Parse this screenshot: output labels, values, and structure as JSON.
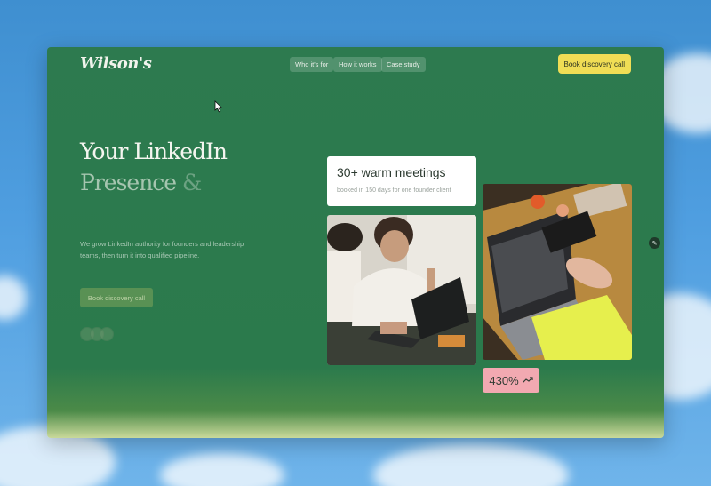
{
  "brand": {
    "logo_text": "Wilson's"
  },
  "nav": {
    "links": [
      {
        "label": "Who it's for"
      },
      {
        "label": "How it works"
      },
      {
        "label": "Case study"
      }
    ],
    "cta_label": "Book discovery call"
  },
  "hero": {
    "headline_line1": "Your LinkedIn",
    "headline_line2": "Presence",
    "headline_amp": "&",
    "subtext": "We grow LinkedIn authority for founders and leadership teams, then turn it into qualified pipeline.",
    "cta_label": "Book discovery call"
  },
  "stat_card": {
    "title": "30+ warm meetings",
    "subtitle": "booked in 150 days for one founder client"
  },
  "growth_badge": {
    "value": "430%",
    "icon": "trend-up-icon"
  },
  "colors": {
    "sky": "#4f9ee0",
    "panel_green": "#2d7a4f",
    "cta_yellow": "#f0dd55",
    "badge_pink": "#f2a9b1"
  }
}
